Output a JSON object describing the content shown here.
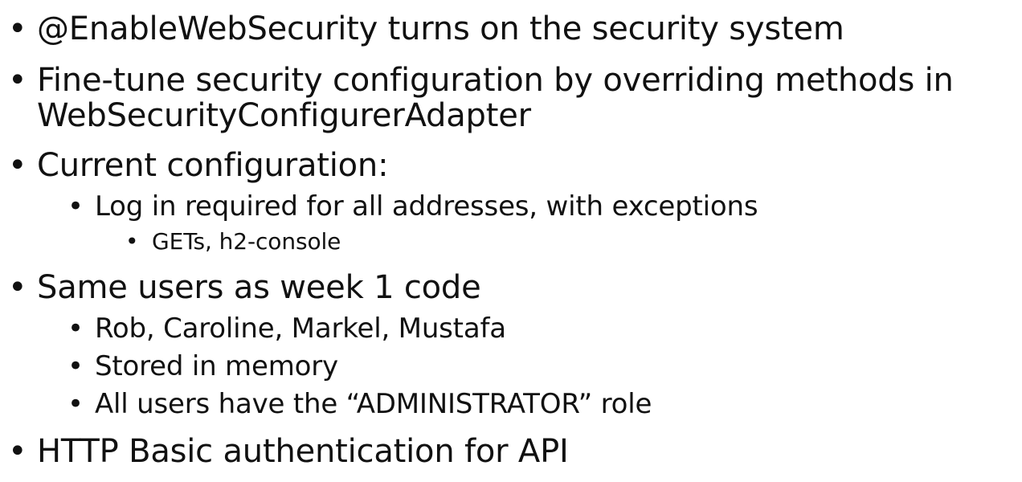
{
  "bullet_glyph": "•",
  "items": [
    {
      "level": 1,
      "text": "@EnableWebSecurity turns on the security system"
    },
    {
      "level": 1,
      "text": "Fine-tune security configuration by overriding methods in"
    },
    {
      "level": 1,
      "text": "WebSecurityConfigurerAdapter",
      "continuation": true
    },
    {
      "level": 1,
      "text": "Current configuration:"
    },
    {
      "level": 2,
      "text": "Log in required for all addresses, with exceptions"
    },
    {
      "level": 3,
      "text": "GETs, h2-console"
    },
    {
      "level": 1,
      "text": "Same users as week 1 code"
    },
    {
      "level": 2,
      "text": "Rob, Caroline, Markel, Mustafa"
    },
    {
      "level": 2,
      "text": "Stored in memory"
    },
    {
      "level": 2,
      "text": "All users have the “ADMINISTRATOR” role"
    },
    {
      "level": 1,
      "text": "HTTP Basic authentication for API"
    }
  ]
}
